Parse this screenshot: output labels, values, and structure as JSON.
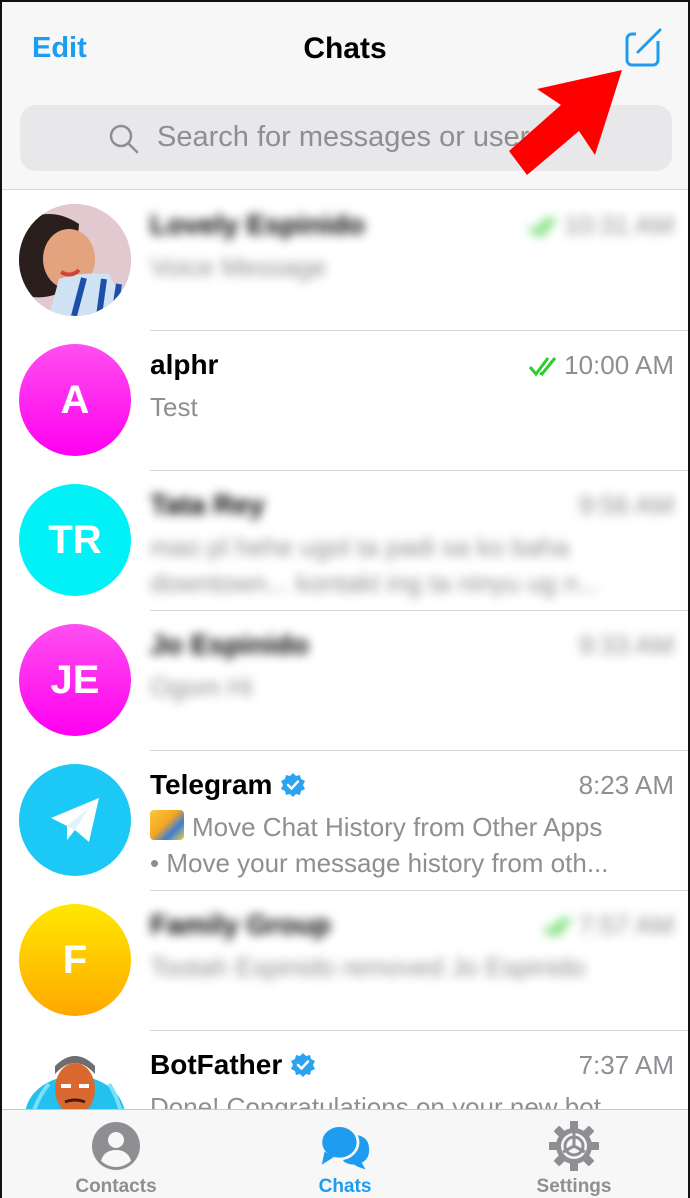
{
  "header": {
    "edit_label": "Edit",
    "title": "Chats",
    "compose_icon": "compose-icon",
    "search_placeholder": "Search for messages or users"
  },
  "annotation": {
    "type": "red-arrow",
    "points_to": "compose-button",
    "color": "#ff0000"
  },
  "colors": {
    "accent": "#1e9cf0",
    "secondary_text": "#8e8e93",
    "read_check": "#2ecc2e"
  },
  "chats": [
    {
      "name": "Lovely Espinido",
      "time": "10:31 AM",
      "message": "Voice Message",
      "message2": "",
      "avatar_initials": "",
      "avatar_type": "photo",
      "blurred": true,
      "read": true,
      "verified": false
    },
    {
      "name": "alphr",
      "time": "10:00 AM",
      "message": "Test",
      "message2": "",
      "avatar_initials": "A",
      "avatar_color": "#ff1ee6",
      "blurred": false,
      "read": true,
      "verified": false
    },
    {
      "name": "Tata Rey",
      "time": "9:56 AM",
      "message": "mao pl hehe ugol ta padi sa ko baha",
      "message2": "downtown... kontakt ing ta ninyu ug n...",
      "avatar_initials": "TR",
      "avatar_color": "#00f0f5",
      "blurred": true,
      "read": false,
      "verified": false
    },
    {
      "name": "Jo Espinido",
      "time": "9:33 AM",
      "message": "Ogom Hi",
      "message2": "",
      "avatar_initials": "JE",
      "avatar_color": "#ff1ee6",
      "blurred": true,
      "read": false,
      "verified": false
    },
    {
      "name": "Telegram",
      "time": "8:23 AM",
      "message": "Move Chat History from Other Apps",
      "message2": "• Move your message history from oth...",
      "avatar_initials": "",
      "avatar_type": "telegram-logo",
      "avatar_color": "#1cc8f5",
      "blurred": false,
      "read": false,
      "verified": true
    },
    {
      "name": "Family Group",
      "time": "7:57 AM",
      "message": "Tootah Espinido removed Jo Espinido",
      "message2": "",
      "avatar_initials": "F",
      "avatar_color": "#ffc800",
      "blurred": true,
      "read": true,
      "verified": false
    },
    {
      "name": "BotFather",
      "time": "7:37 AM",
      "message": "Done! Congratulations on your new bot.",
      "message2": "",
      "avatar_initials": "",
      "avatar_type": "botfather-photo",
      "blurred": false,
      "read": false,
      "verified": true
    }
  ],
  "tabbar": {
    "tabs": [
      {
        "label": "Contacts",
        "icon": "person-icon",
        "active": false
      },
      {
        "label": "Chats",
        "icon": "chat-bubbles-icon",
        "active": true
      },
      {
        "label": "Settings",
        "icon": "gear-icon",
        "active": false
      }
    ]
  }
}
